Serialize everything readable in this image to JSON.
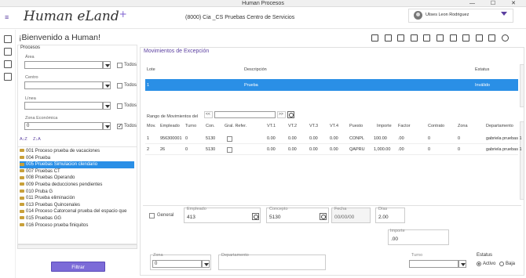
{
  "window": {
    "title": "Human Procesos"
  },
  "header": {
    "logo": "Human eLand",
    "company": "(8000) Cia _CS  Pruebas Centro de Servicios",
    "user": "Ulises Leon Rodriguez"
  },
  "welcome": "¡Bienvenido a Human!",
  "procesos": {
    "title": "Procesos",
    "area_label": "Área",
    "centro_label": "Centro",
    "linea_label": "Línea",
    "zona_label": "Zona Económica",
    "zona_value": "0",
    "todos": "Todos",
    "sort1": "A↓Z",
    "sort2": "Z↓A",
    "items": [
      {
        "code": "001",
        "name": "Proceso prueba de vacaciones"
      },
      {
        "code": "004",
        "name": "Prueba"
      },
      {
        "code": "005",
        "name": "Pruebas Simulacion clendario"
      },
      {
        "code": "007",
        "name": "Pruebas CT"
      },
      {
        "code": "008",
        "name": "Pruebas Operando"
      },
      {
        "code": "009",
        "name": "Prueba deducciones pendientes"
      },
      {
        "code": "010",
        "name": "Pruba G"
      },
      {
        "code": "011",
        "name": "Prueba eliminación"
      },
      {
        "code": "013",
        "name": "Pruebas Quincenales"
      },
      {
        "code": "014",
        "name": "Proceso Catorcenal prueba del espacio que"
      },
      {
        "code": "015",
        "name": "Pruebas GG"
      },
      {
        "code": "016",
        "name": "Proceso prueba finiquitos"
      }
    ],
    "filter_button": "Filtrar"
  },
  "movimientos": {
    "title": "Movimientos de Excepción",
    "lote_headers": [
      "Lote",
      "Descripción",
      "Estatus"
    ],
    "lote_row": {
      "lote": "1",
      "descripcion": "Prueba",
      "estatus": "Inválido"
    },
    "rango_label": "Rango de Movimientos del",
    "nav_prev": "<<",
    "nav_next": ">>",
    "headers": [
      "Mov.",
      "Empleado",
      "Turno",
      "Con.",
      "Gral. Refer.",
      "VT.1",
      "VT.2",
      "VT.3",
      "VT.4",
      "Puesto",
      "Importe",
      "Factor",
      "Contrato",
      "Zona",
      "Departamento"
    ],
    "rows": [
      {
        "mov": "1",
        "empleado": "956300001",
        "turno": "0",
        "con": "5130",
        "vt1": "0.00",
        "vt2": "0.00",
        "vt3": "0.00",
        "vt4": "0.00",
        "puesto": "CONPL",
        "importe": "100.00",
        "factor": ".00",
        "contrato": "0",
        "zona": "0",
        "depto": "gabriela pruebas 1"
      },
      {
        "mov": "2",
        "empleado": "26",
        "turno": "0",
        "con": "5130",
        "vt1": "0.00",
        "vt2": "0.00",
        "vt3": "0.00",
        "vt4": "0.00",
        "puesto": "QAPRU",
        "importe": "1,000.00",
        "factor": ".00",
        "contrato": "0",
        "zona": "0",
        "depto": "gabriela pruebas 1"
      }
    ]
  },
  "form": {
    "general_label": "General",
    "empleado_label": "Empleado",
    "empleado_value": "413",
    "concepto_label": "Concepto",
    "concepto_value": "5130",
    "fecha_label": "Fecha",
    "fecha_value": "00/00/00",
    "dias_label": "Días",
    "dias_value": "2.00",
    "importe_label": "Importe",
    "importe_value": ".00",
    "zona_label": "Zona",
    "zona_value": "0",
    "departamento_label": "Departamento",
    "turno_label": "Turno",
    "estatus_label": "Estatus",
    "activo": "Activo",
    "baja": "Baja"
  }
}
